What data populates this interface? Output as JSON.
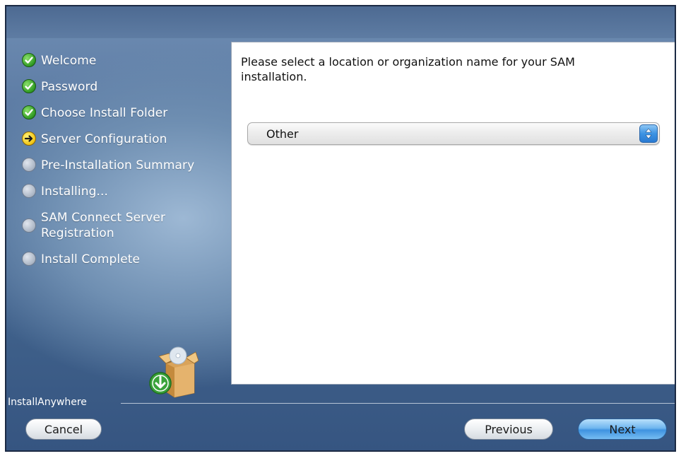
{
  "steps": [
    {
      "label": "Welcome",
      "state": "done"
    },
    {
      "label": "Password",
      "state": "done"
    },
    {
      "label": "Choose Install Folder",
      "state": "done"
    },
    {
      "label": "Server Configuration",
      "state": "current"
    },
    {
      "label": "Pre-Installation Summary",
      "state": "pending"
    },
    {
      "label": "Installing...",
      "state": "pending"
    },
    {
      "label": "SAM Connect Server Registration",
      "state": "pending"
    },
    {
      "label": "Install Complete",
      "state": "pending"
    }
  ],
  "main": {
    "prompt": "Please select a location or organization name for your SAM installation.",
    "location_select": {
      "value": "Other"
    }
  },
  "footer": {
    "brand": "InstallAnywhere",
    "cancel_label": "Cancel",
    "previous_label": "Previous",
    "next_label": "Next"
  },
  "colors": {
    "background_blue": "#4f6f99",
    "done": "#2f9a22",
    "current": "#f2c513",
    "pending": "#aab5c4",
    "primary_button": "#3f93e0"
  },
  "icons": {
    "done": "check-circle-icon",
    "current": "arrow-right-circle-icon",
    "pending": "empty-circle-icon",
    "select": "up-down-arrows-icon",
    "logo": "installer-box-icon"
  }
}
